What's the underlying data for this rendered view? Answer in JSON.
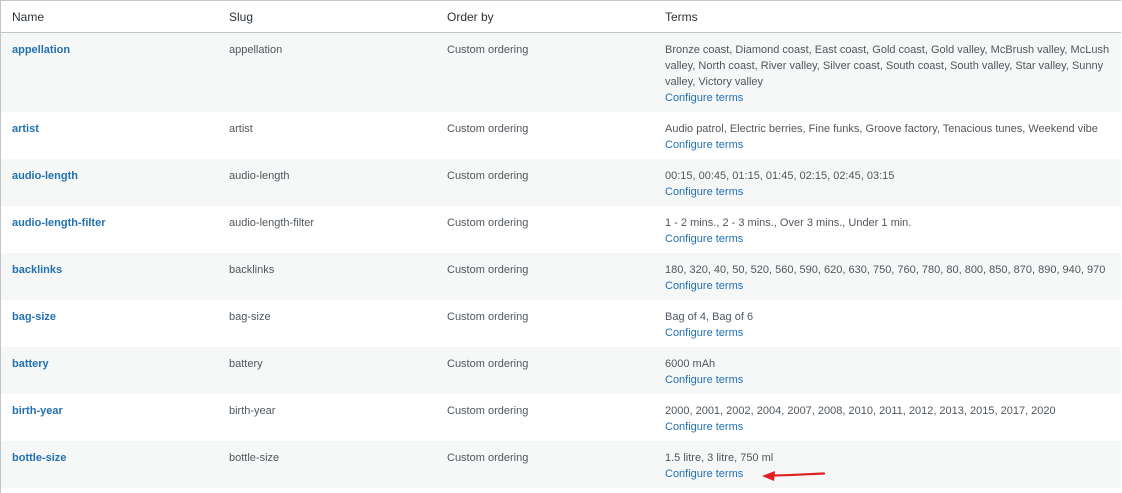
{
  "headers": {
    "name": "Name",
    "slug": "Slug",
    "order": "Order by",
    "terms": "Terms"
  },
  "configure_label": "Configure terms",
  "rows": [
    {
      "name": "appellation",
      "slug": "appellation",
      "order": "Custom ordering",
      "terms": "Bronze coast, Diamond coast, East coast, Gold coast, Gold valley, McBrush valley, McLush valley, North coast, River valley, Silver coast, South coast, South valley, Star valley, Sunny valley, Victory valley"
    },
    {
      "name": "artist",
      "slug": "artist",
      "order": "Custom ordering",
      "terms": "Audio patrol, Electric berries, Fine funks, Groove factory, Tenacious tunes, Weekend vibe"
    },
    {
      "name": "audio-length",
      "slug": "audio-length",
      "order": "Custom ordering",
      "terms": "00:15, 00:45, 01:15, 01:45, 02:15, 02:45, 03:15"
    },
    {
      "name": "audio-length-filter",
      "slug": "audio-length-filter",
      "order": "Custom ordering",
      "terms": "1 - 2 mins., 2 - 3 mins., Over 3 mins., Under 1 min."
    },
    {
      "name": "backlinks",
      "slug": "backlinks",
      "order": "Custom ordering",
      "terms": "180, 320, 40, 50, 520, 560, 590, 620, 630, 750, 760, 780, 80, 800, 850, 870, 890, 940, 970"
    },
    {
      "name": "bag-size",
      "slug": "bag-size",
      "order": "Custom ordering",
      "terms": "Bag of 4, Bag of 6"
    },
    {
      "name": "battery",
      "slug": "battery",
      "order": "Custom ordering",
      "terms": "6000 mAh"
    },
    {
      "name": "birth-year",
      "slug": "birth-year",
      "order": "Custom ordering",
      "terms": "2000, 2001, 2002, 2004, 2007, 2008, 2010, 2011, 2012, 2013, 2015, 2017, 2020"
    },
    {
      "name": "bottle-size",
      "slug": "bottle-size",
      "order": "Custom ordering",
      "terms": "1.5 litre, 3 litre, 750 ml"
    }
  ],
  "colors": {
    "link": "#2271b1",
    "arrow": "#e02020",
    "row_alt": "#f6f7f7"
  },
  "annotation_icon": "red-arrow-icon"
}
